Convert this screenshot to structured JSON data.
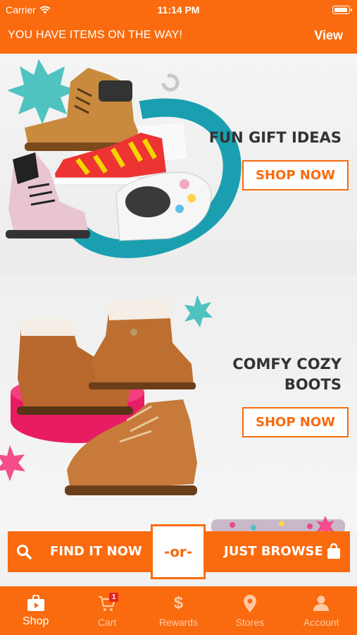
{
  "status_bar": {
    "carrier": "Carrier",
    "time": "11:14 PM"
  },
  "promo_bar": {
    "message": "YOU HAVE ITEMS ON THE WAY!",
    "view_label": "View"
  },
  "banners": [
    {
      "heading_lines": [
        "FUN GIFT IDEAS"
      ],
      "button_label": "SHOP NOW"
    },
    {
      "heading_lines": [
        "COMFY COZY",
        "BOOTS"
      ],
      "button_label": "SHOP NOW"
    }
  ],
  "actions": {
    "find_label": "FIND IT NOW",
    "or_label": "-or-",
    "browse_label": "JUST BROWSE"
  },
  "tabs": [
    {
      "label": "Shop",
      "icon": "shopping-bag-icon",
      "active": true
    },
    {
      "label": "Cart",
      "icon": "cart-icon",
      "badge": "1",
      "active": false
    },
    {
      "label": "Rewards",
      "icon": "dollar-icon",
      "active": false
    },
    {
      "label": "Stores",
      "icon": "map-pin-icon",
      "active": false
    },
    {
      "label": "Account",
      "icon": "person-icon",
      "active": false
    }
  ],
  "colors": {
    "brand_orange": "#f96b0e",
    "heading": "#333333",
    "badge_red": "#e8231f"
  }
}
